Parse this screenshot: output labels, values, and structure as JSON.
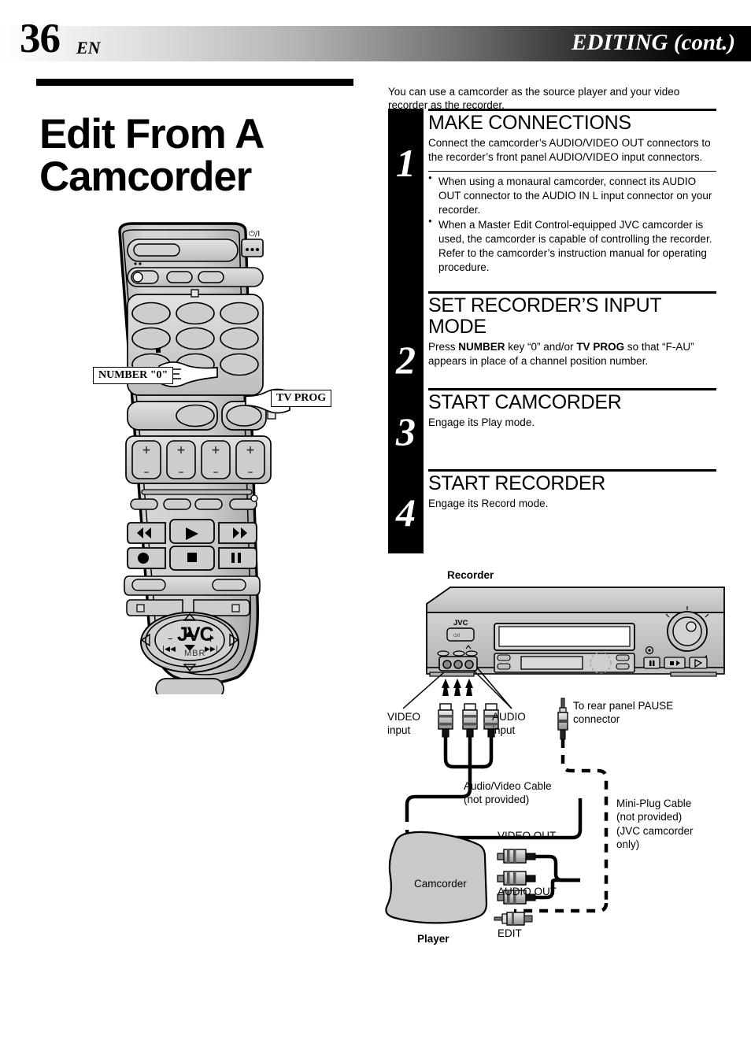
{
  "header": {
    "page_number": "36",
    "language": "EN",
    "section_title": "EDITING (cont.)"
  },
  "document": {
    "title_line1": "Edit From A",
    "title_line2": "Camcorder",
    "intro": "You can use a camcorder as the source player and your video recorder as the recorder."
  },
  "steps": [
    {
      "number": "1",
      "heading": "MAKE CONNECTIONS",
      "text": "Connect the camcorder’s AUDIO/VIDEO OUT connectors to the recorder’s front panel AUDIO/VIDEO input connectors.",
      "notes": [
        "When using a monaural camcorder, connect its AUDIO OUT connector to the AUDIO IN L input connector on your recorder.",
        "When a Master Edit Control-equipped JVC camcorder is used, the camcorder is capable of controlling the recorder. Refer to the camcorder’s instruction manual for operating procedure."
      ]
    },
    {
      "number": "2",
      "heading": "SET RECORDER’S INPUT MODE",
      "text_parts": [
        {
          "t": "Press ",
          "b": false
        },
        {
          "t": "NUMBER",
          "b": true
        },
        {
          "t": " key “0” and/or ",
          "b": false
        },
        {
          "t": "TV PROG",
          "b": true
        },
        {
          "t": " so that “F-AU” appears in place of a channel position number.",
          "b": false
        }
      ],
      "notes": []
    },
    {
      "number": "3",
      "heading": "START CAMCORDER",
      "text": "Engage its Play mode.",
      "notes": []
    },
    {
      "number": "4",
      "heading": "START RECORDER",
      "text": "Engage its Record mode.",
      "notes": []
    }
  ],
  "remote": {
    "brand": "JVC",
    "model_mark": "MBR",
    "callouts": [
      {
        "id": "number-zero",
        "label": "NUMBER \"0\""
      },
      {
        "id": "tv-prog",
        "label": "TV PROG"
      }
    ]
  },
  "diagram": {
    "recorder_label": "Recorder",
    "recorder_brand": "JVC",
    "video_input_line1": "VIDEO",
    "video_input_line2": "input",
    "audio_input_line1": "AUDIO",
    "audio_input_line2": "input",
    "pause_note_line1": "To rear panel PAUSE",
    "pause_note_line2": "connector",
    "av_cable_line1": "Audio/Video Cable",
    "av_cable_line2": "(not provided)",
    "mini_plug_line1": "Mini-Plug Cable",
    "mini_plug_line2": "(not provided)",
    "mini_plug_line3": "(JVC camcorder",
    "mini_plug_line4": "only)",
    "video_out": "VIDEO OUT",
    "audio_out": "AUDIO OUT",
    "edit": "EDIT",
    "camcorder_label": "Camcorder",
    "player_label": "Player"
  },
  "colors": {
    "ink": "#000000",
    "panel_gray": "#c9c9c9",
    "panel_gray_light": "#dcdcdc",
    "panel_gray_dark": "#a8a8a8",
    "paper": "#ffffff"
  }
}
